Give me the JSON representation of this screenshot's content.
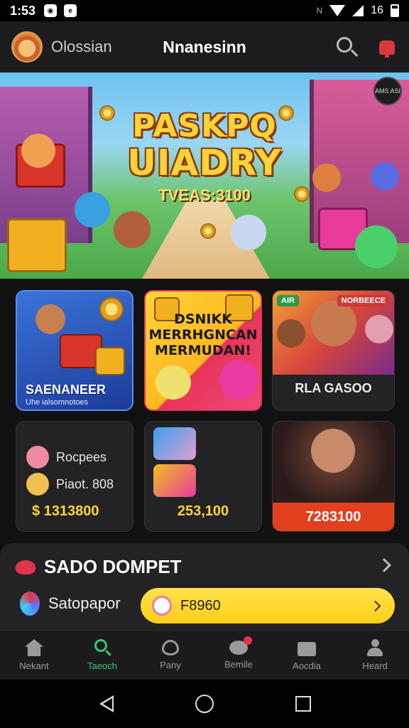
{
  "status_bar": {
    "time": "1:53",
    "right_text": "16"
  },
  "header": {
    "username": "Olossian",
    "title": "Nnanesinn"
  },
  "banner": {
    "title_line1": "PASKPQ",
    "title_line2": "UIADRY",
    "subtitle": "TVEAS:3100",
    "corner_badge": "AMS ASI"
  },
  "cards": {
    "card1": {
      "title": "SAENANEER",
      "subtitle": "Uhe ialsomnotoes"
    },
    "card2": {
      "text_line1": "DSNIKK",
      "text_line2": "MERRHGNCAN",
      "text_line3": "MERMUDAN!"
    },
    "card3": {
      "label": "RLA GASOO",
      "tag_right": "NORBEECE",
      "tag_left": "AIR"
    },
    "card4": {
      "item1": "Rocpees",
      "item2": "Piaot. 808",
      "price": "$ 1313800"
    },
    "card5": {
      "price": "253,100"
    },
    "card6": {
      "price": "7283100"
    }
  },
  "wallet": {
    "title": "SADO DOMPET",
    "row_label": "Satopapor",
    "pill_text": "F8960"
  },
  "bottom_nav": [
    {
      "label": "Nekant",
      "icon": "home-icon"
    },
    {
      "label": "Taeoch",
      "icon": "search-icon"
    },
    {
      "label": "Pany",
      "icon": "heart-icon"
    },
    {
      "label": "Bemile",
      "icon": "chat-icon"
    },
    {
      "label": "Aocdia",
      "icon": "bag-icon"
    },
    {
      "label": "Heard",
      "icon": "person-icon"
    }
  ],
  "colors": {
    "accent": "#2ecc71",
    "gold": "#ffd23a",
    "danger": "#e0401e",
    "background": "#111111"
  }
}
